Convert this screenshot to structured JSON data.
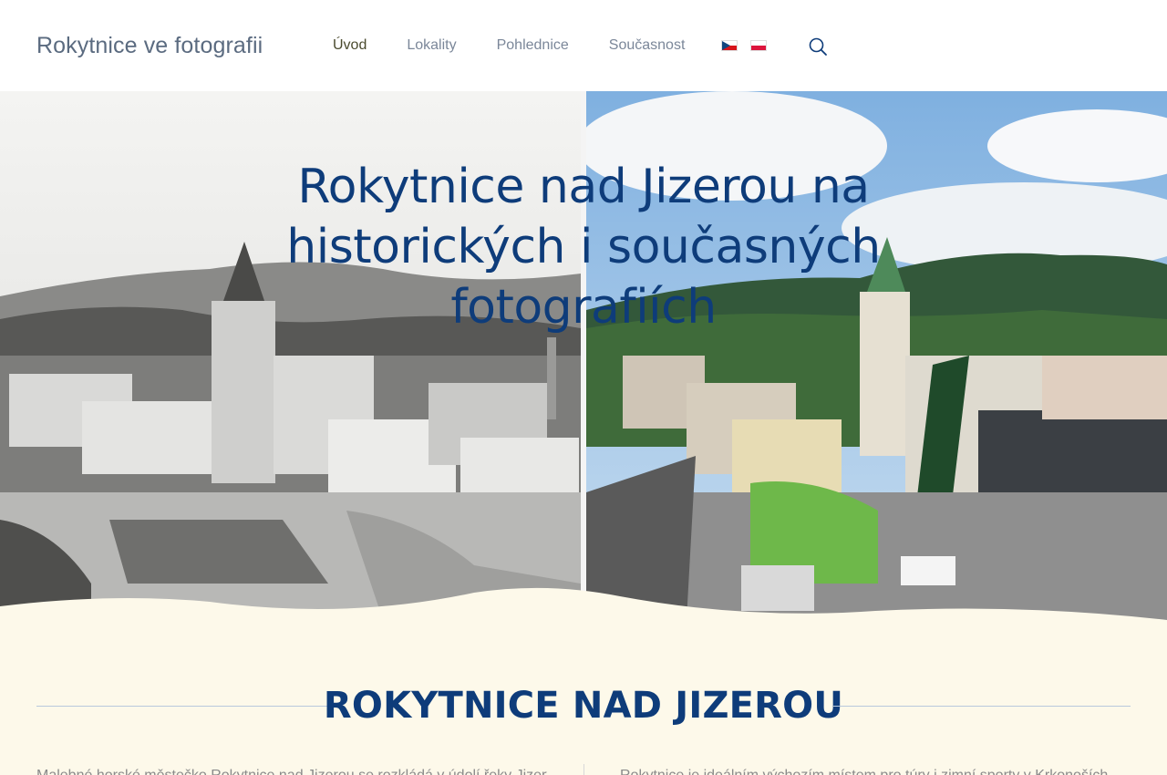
{
  "header": {
    "site_title": "Rokytnice ve fotografii",
    "nav": [
      {
        "label": "Úvod",
        "active": true
      },
      {
        "label": "Lokality",
        "active": false
      },
      {
        "label": "Pohlednice",
        "active": false
      },
      {
        "label": "Současnost",
        "active": false
      }
    ],
    "languages": [
      "cz-flag-icon",
      "pl-flag-icon"
    ],
    "search_icon": "search-icon"
  },
  "hero": {
    "title": "Rokytnice nad Jizerou na historických i současných fotografiích"
  },
  "section": {
    "heading": "ROKYTNICE NAD JIZEROU",
    "left_text": "Malebné horské městečko Rokytnice nad Jizerou se rozkládá v údolí řeky Jizery",
    "right_text": "Rokytnice je ideálním výchozím místem pro túry i zimní sporty v Krkonoších"
  },
  "colors": {
    "accent": "#0e3c7a",
    "background": "#fdf9ea",
    "active_highlight": "#fbeec3"
  }
}
